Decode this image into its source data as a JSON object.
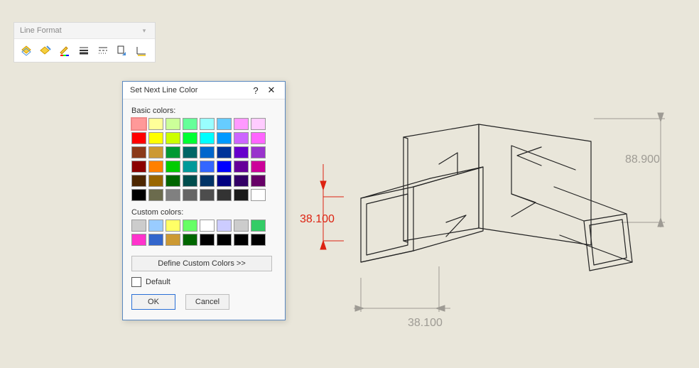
{
  "toolbar": {
    "title": "Line Format",
    "icons": [
      "layer-icon",
      "edit-layer-icon",
      "line-color-icon",
      "line-thickness-icon",
      "line-style-icon",
      "hide-show-icon",
      "color-display-icon"
    ]
  },
  "dialog": {
    "title": "Set Next Line Color",
    "help_glyph": "?",
    "close_glyph": "✕",
    "basic_label": "Basic colors:",
    "custom_label": "Custom colors:",
    "define_label": "Define Custom Colors >>",
    "default_label": "Default",
    "ok_label": "OK",
    "cancel_label": "Cancel",
    "basic_colors": [
      [
        "#ff9999",
        "#ffff99",
        "#ccff99",
        "#66ff99",
        "#99ffff",
        "#66ccff",
        "#ff99ff",
        "#ffccff"
      ],
      [
        "#ff0000",
        "#ffff00",
        "#ccff00",
        "#00ff33",
        "#00ffff",
        "#0099ff",
        "#cc66ff",
        "#ff66ff"
      ],
      [
        "#8b3a1a",
        "#cc9933",
        "#009933",
        "#006666",
        "#0066cc",
        "#003399",
        "#6600cc",
        "#9933cc"
      ],
      [
        "#8b0000",
        "#ff8000",
        "#00cc00",
        "#009999",
        "#3366ff",
        "#0000ff",
        "#660099",
        "#cc0099"
      ],
      [
        "#4d2600",
        "#996600",
        "#006600",
        "#004d4d",
        "#003366",
        "#000080",
        "#330066",
        "#660066"
      ],
      [
        "#000000",
        "#6b6b4d",
        "#808080",
        "#666666",
        "#4d4d4d",
        "#333333",
        "#1a1a1a",
        "#ffffff"
      ]
    ],
    "custom_colors": [
      [
        "#cccccc",
        "#99ccff",
        "#ffff66",
        "#66ff66",
        "#ffffff",
        "#ccccff",
        "#cccccc",
        "#33cc66"
      ],
      [
        "#ff33cc",
        "#3366cc",
        "#cc9933",
        "#006600",
        "#000000",
        "#000000",
        "#000000",
        "#000000"
      ]
    ],
    "selected_index": 0
  },
  "drawing": {
    "dim_left": "38.100",
    "dim_bottom": "38.100",
    "dim_right": "88.900"
  }
}
